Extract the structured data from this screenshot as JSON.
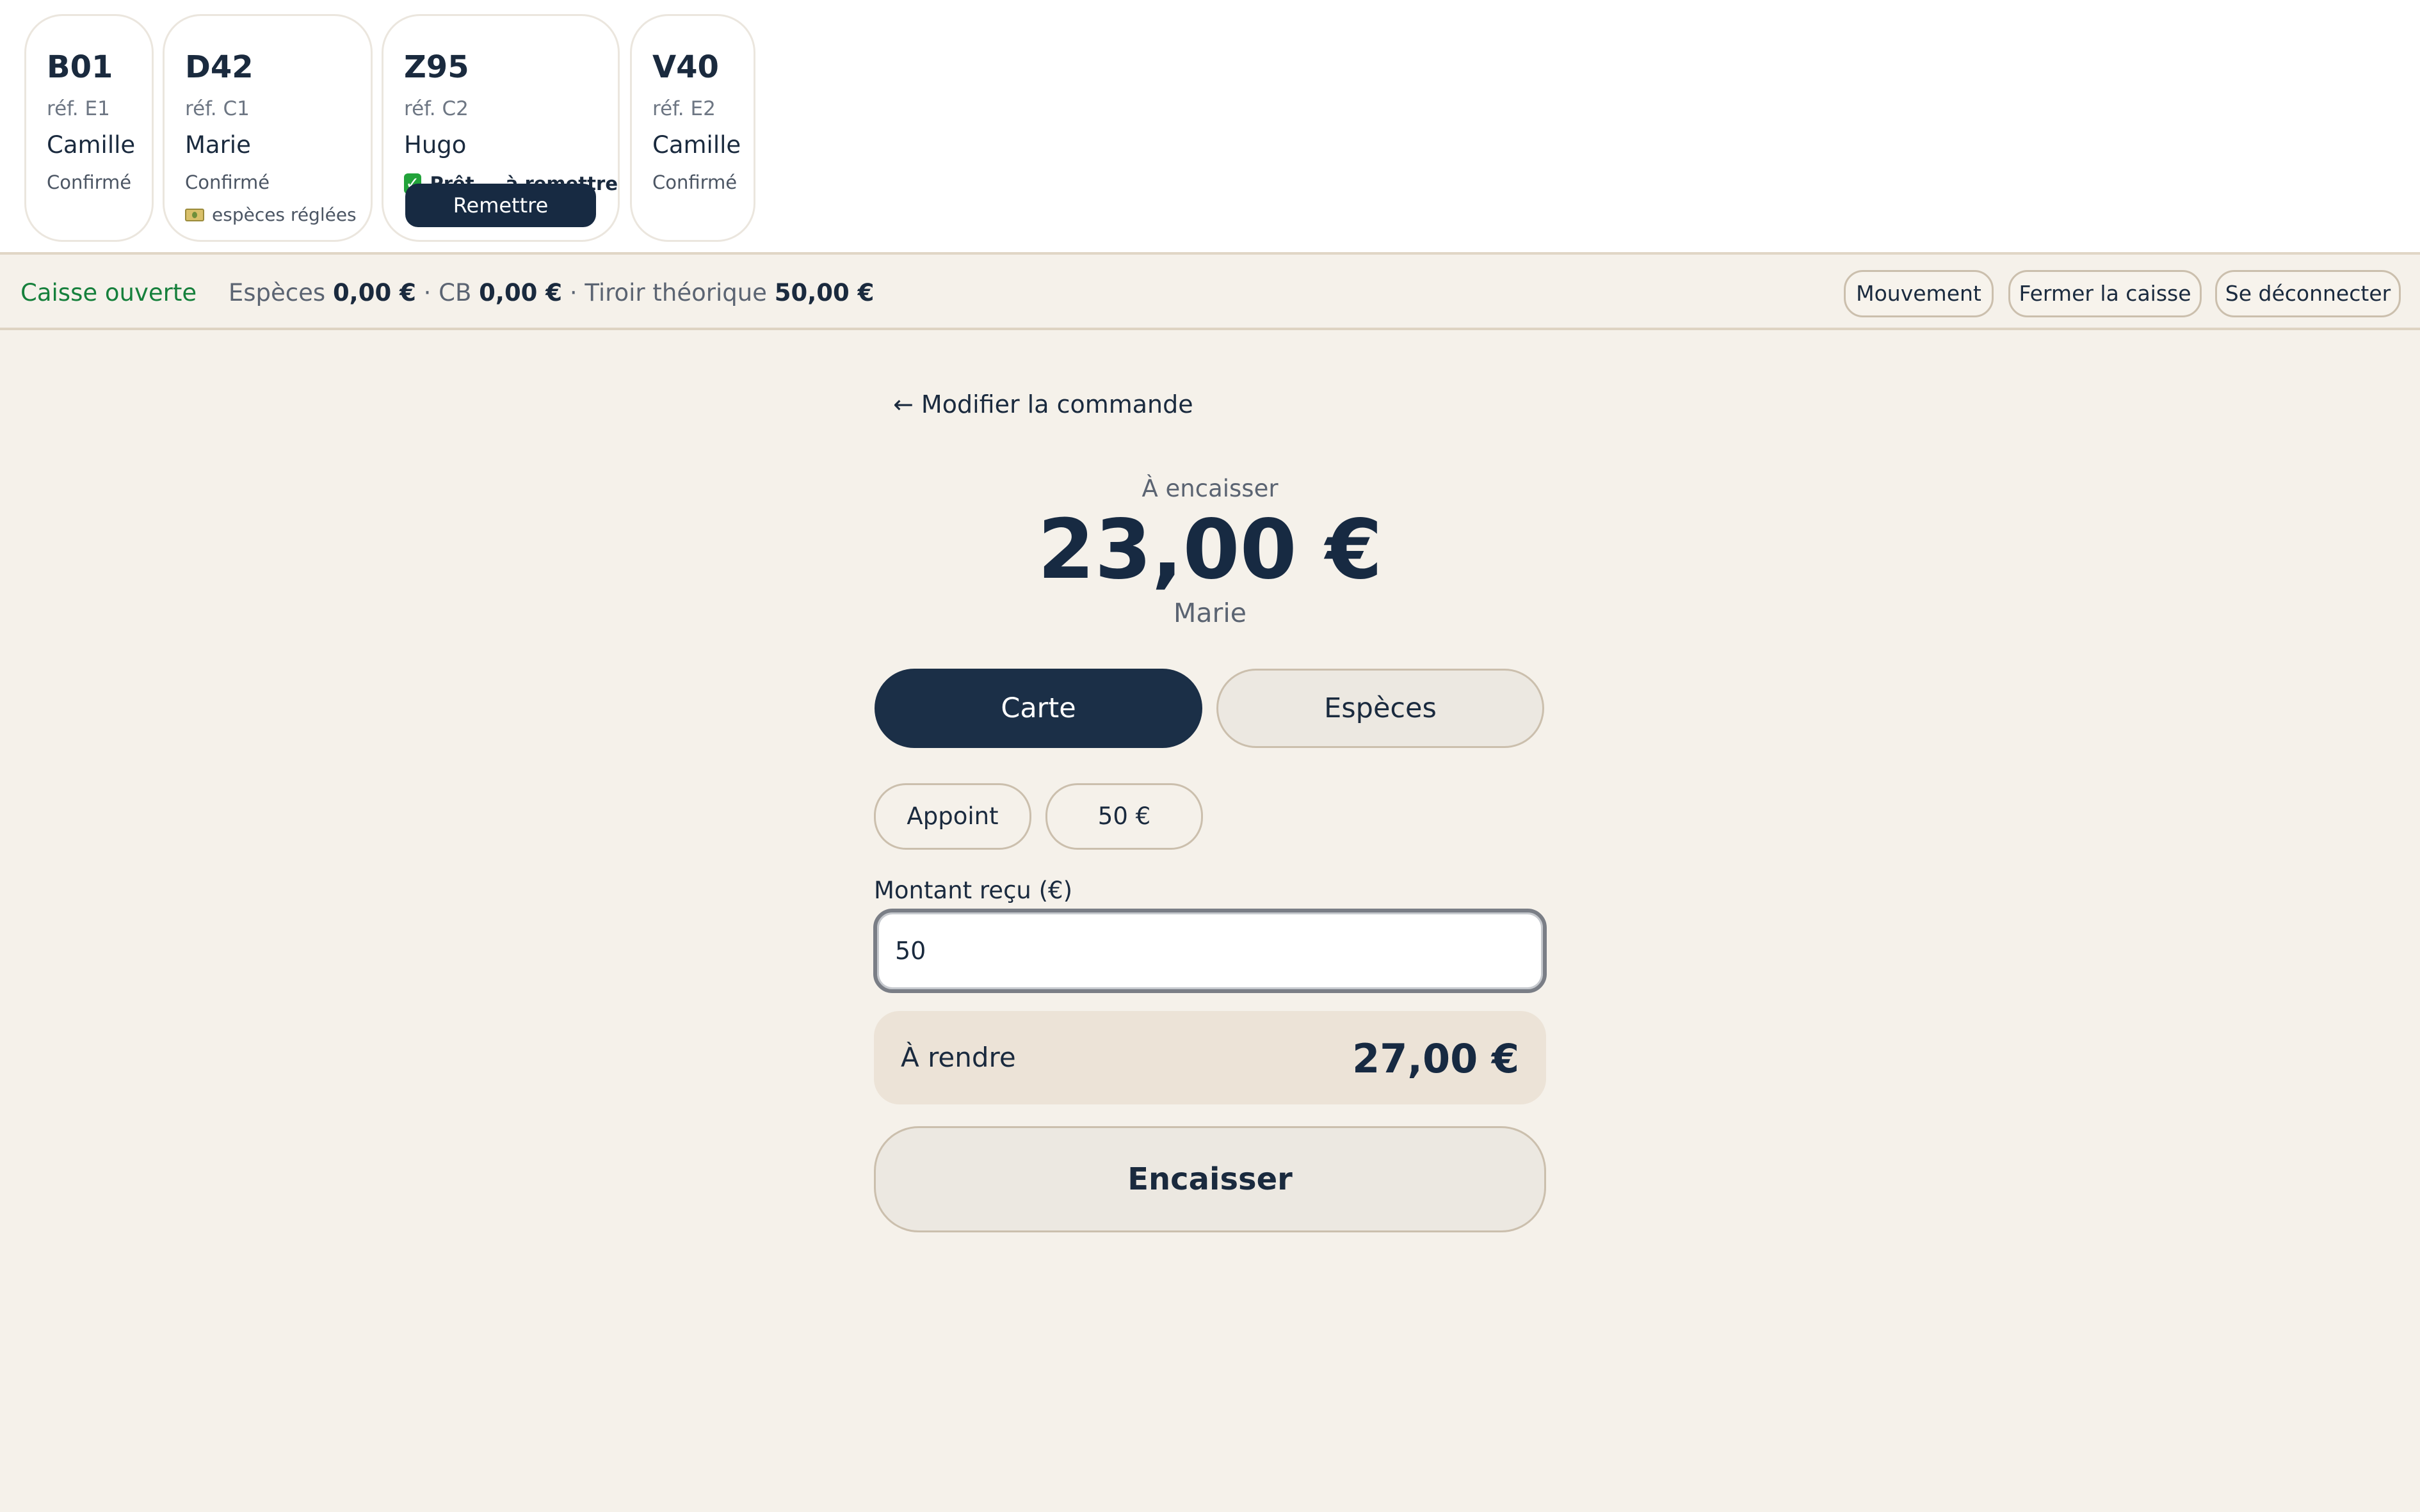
{
  "orders": [
    {
      "code": "B01",
      "ref": "réf. E1",
      "client": "Camille",
      "status": "Confirmé"
    },
    {
      "code": "D42",
      "ref": "réf. C1",
      "client": "Marie",
      "status": "Confirmé",
      "note": "espèces réglées"
    },
    {
      "code": "Z95",
      "ref": "réf. C2",
      "client": "Hugo",
      "status": "Prêt — à remettre",
      "action": "Remettre"
    },
    {
      "code": "V40",
      "ref": "réf. E2",
      "client": "Camille",
      "status": "Confirmé"
    }
  ],
  "register": {
    "state": "Caisse ouverte",
    "cash_label": "Espèces",
    "cash_value": "0,00 €",
    "card_label": "CB",
    "card_value": "0,00 €",
    "drawer_label": "Tiroir théorique",
    "drawer_value": "50,00 €",
    "sep": "·"
  },
  "header_actions": {
    "movement": "Mouvement",
    "close": "Fermer la caisse",
    "logout": "Se déconnecter"
  },
  "checkout": {
    "back": "← Modifier la commande",
    "due_label": "À encaisser",
    "due_amount": "23,00 €",
    "client": "Marie",
    "methods": {
      "card": "Carte",
      "cash": "Espèces",
      "selected": "Carte"
    },
    "quick": {
      "exact": "Appoint",
      "fifty": "50 €"
    },
    "received_label": "Montant reçu (€)",
    "received_value": "50",
    "change_label": "À rendre",
    "change_amount": "27,00 €",
    "submit": "Encaisser"
  },
  "colors": {
    "accent_dark": "#1b2f47",
    "open_green": "#16803c",
    "background": "#f5f1ea"
  }
}
